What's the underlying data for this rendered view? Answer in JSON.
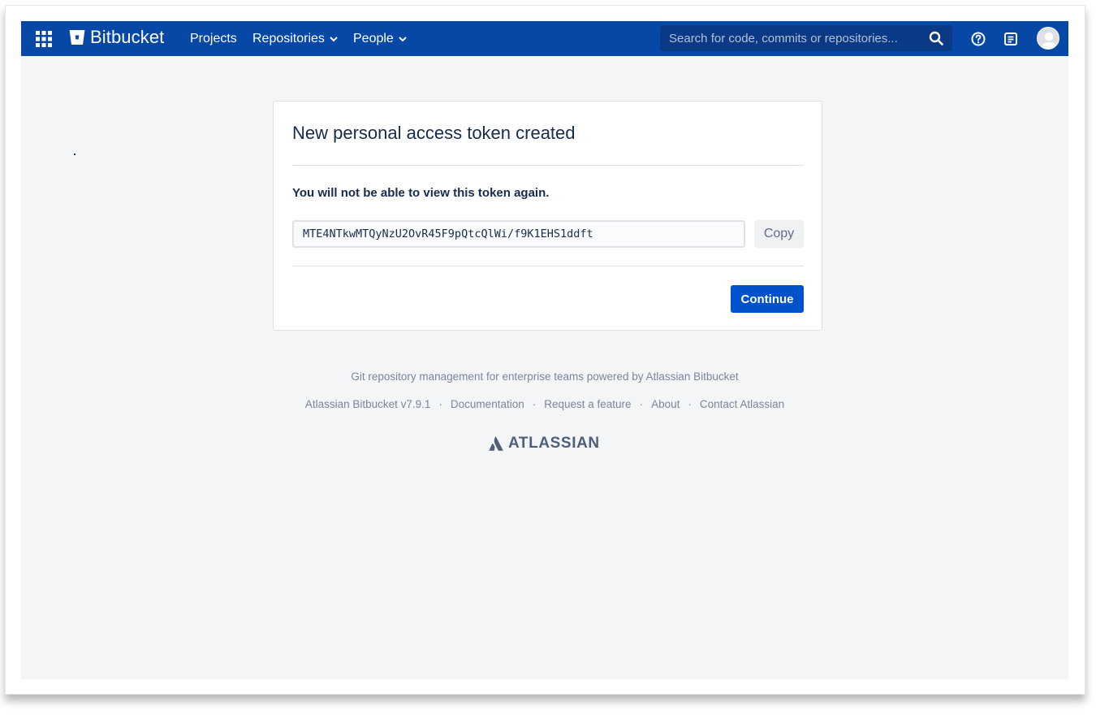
{
  "header": {
    "brand": "Bitbucket",
    "nav": {
      "projects": "Projects",
      "repositories": "Repositories",
      "people": "People"
    },
    "search_placeholder": "Search for code, commits or repositories...",
    "icons": [
      "apps-grid-icon",
      "bitbucket-logo-icon",
      "search-icon",
      "help-icon",
      "whats-new-icon",
      "avatar"
    ]
  },
  "dialog": {
    "title": "New personal access token created",
    "warning": "You will not be able to view this token again.",
    "token": "MTE4NTkwMTQyNzU2OvR45F9pQtcQlWi/f9K1EHS1ddft",
    "copy_label": "Copy",
    "continue_label": "Continue"
  },
  "footer": {
    "tagline": "Git repository management for enterprise teams powered by Atlassian Bitbucket",
    "links": {
      "version": "Atlassian Bitbucket v7.9.1",
      "documentation": "Documentation",
      "request_feature": "Request a feature",
      "about": "About",
      "contact": "Contact Atlassian"
    },
    "separator": "·",
    "brand": "ATLASSIAN"
  },
  "colors": {
    "header_bg": "#0747a6",
    "primary_button": "#0052cc",
    "page_bg": "#f4f5f7",
    "text_dark": "#172b4d",
    "text_muted": "#7a869a"
  }
}
